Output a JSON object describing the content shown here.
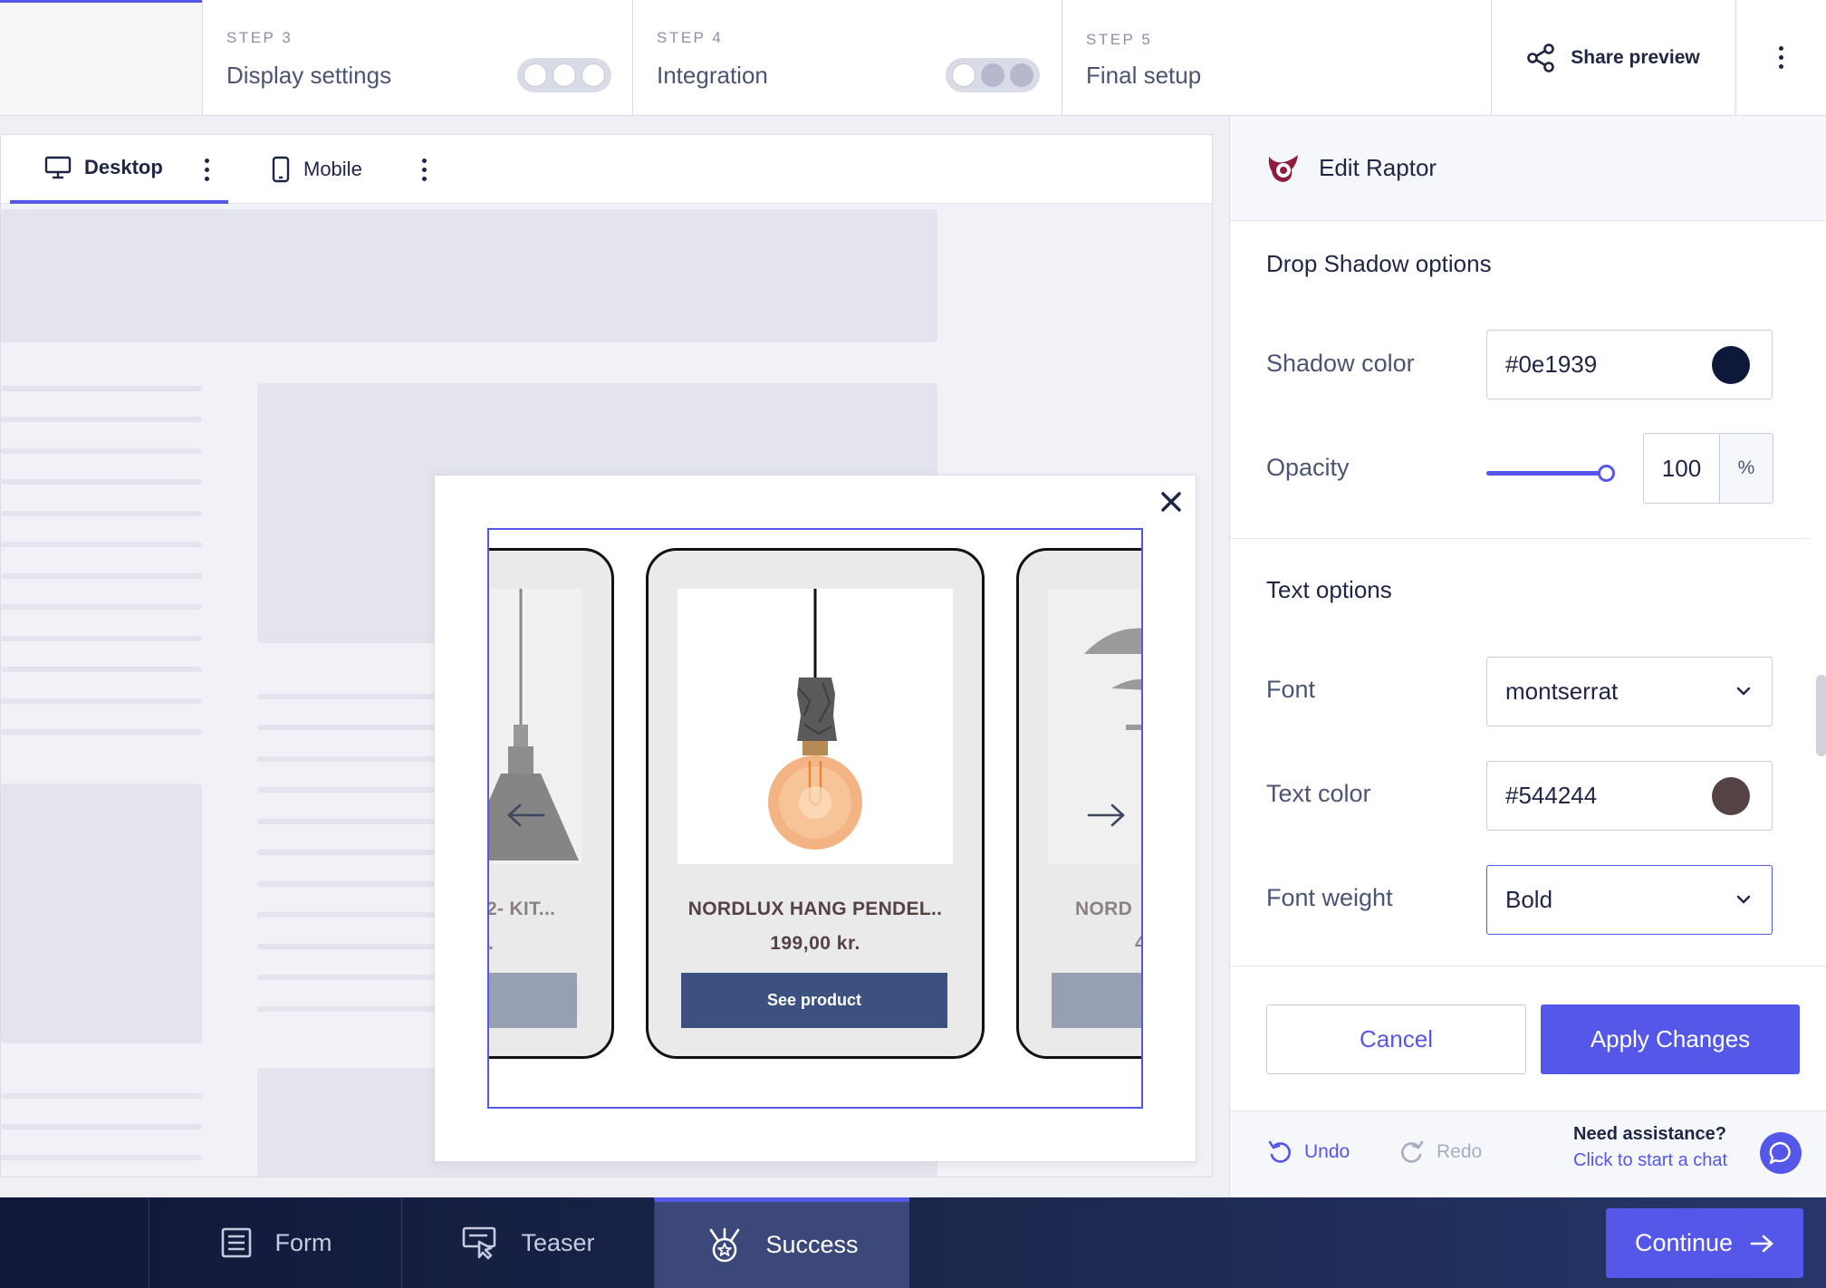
{
  "steps": [
    {
      "number": "STEP 3",
      "title": "Display settings"
    },
    {
      "number": "STEP 4",
      "title": "Integration"
    },
    {
      "number": "STEP 5",
      "title": "Final setup"
    }
  ],
  "header": {
    "share_label": "Share preview"
  },
  "device_tabs": [
    {
      "label": "Desktop",
      "active": true
    },
    {
      "label": "Mobile",
      "active": false
    }
  ],
  "carousel": {
    "products": [
      {
        "name": "2- KIT...",
        "price": ".",
        "button": ""
      },
      {
        "name": "NORDLUX HANG PENDEL..",
        "price": "199,00 kr.",
        "button": "See product"
      },
      {
        "name": "NORD",
        "price": "4",
        "button": ""
      }
    ]
  },
  "panel": {
    "title": "Edit Raptor",
    "drop_shadow": {
      "section_title": "Drop Shadow options",
      "shadow_color_label": "Shadow color",
      "shadow_color_value": "#0e1939",
      "opacity_label": "Opacity",
      "opacity_value": "100",
      "opacity_unit": "%",
      "opacity_fraction": 1.0
    },
    "text_options": {
      "section_title": "Text options",
      "font_label": "Font",
      "font_value": "montserrat",
      "text_color_label": "Text color",
      "text_color_value": "#544244",
      "font_weight_label": "Font weight",
      "font_weight_value": "Bold"
    },
    "cancel_label": "Cancel",
    "apply_label": "Apply Changes",
    "undo_label": "Undo",
    "redo_label": "Redo",
    "help_question": "Need assistance?",
    "help_link": "Click to start a chat"
  },
  "bottom_tabs": [
    {
      "label": "Form",
      "icon": "form-icon"
    },
    {
      "label": "Teaser",
      "icon": "teaser-icon"
    },
    {
      "label": "Success",
      "icon": "success-icon",
      "active": true
    }
  ],
  "continue_label": "Continue",
  "colors": {
    "accent": "#5457e8",
    "shadow_swatch": "#0e1939",
    "text_swatch": "#544244",
    "product_button": "#3d5180"
  }
}
